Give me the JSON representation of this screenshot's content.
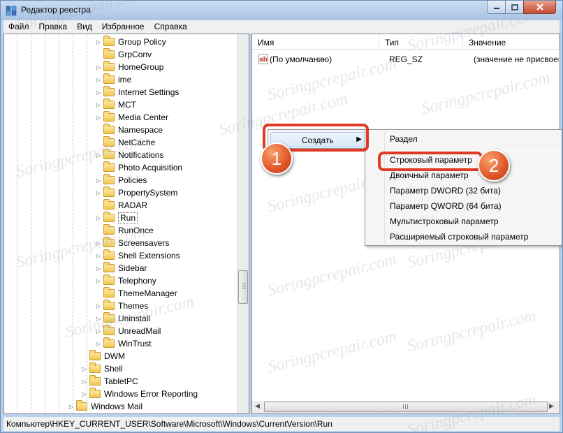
{
  "window": {
    "title": "Редактор реестра",
    "icons": {
      "app": "registry-editor-icon",
      "minimize": "minimize-icon",
      "maximize": "maximize-icon",
      "close": "close-icon"
    }
  },
  "menu": [
    "Файл",
    "Правка",
    "Вид",
    "Избранное",
    "Справка"
  ],
  "tree": {
    "items": [
      {
        "label": "Group Policy",
        "level": 2,
        "expandable": true
      },
      {
        "label": "GrpConv",
        "level": 2,
        "expandable": false
      },
      {
        "label": "HomeGroup",
        "level": 2,
        "expandable": true
      },
      {
        "label": "ime",
        "level": 2,
        "expandable": true
      },
      {
        "label": "Internet Settings",
        "level": 2,
        "expandable": true
      },
      {
        "label": "MCT",
        "level": 2,
        "expandable": true
      },
      {
        "label": "Media Center",
        "level": 2,
        "expandable": true
      },
      {
        "label": "Namespace",
        "level": 2,
        "expandable": false
      },
      {
        "label": "NetCache",
        "level": 2,
        "expandable": false
      },
      {
        "label": "Notifications",
        "level": 2,
        "expandable": true
      },
      {
        "label": "Photo Acquisition",
        "level": 2,
        "expandable": false
      },
      {
        "label": "Policies",
        "level": 2,
        "expandable": true
      },
      {
        "label": "PropertySystem",
        "level": 2,
        "expandable": true
      },
      {
        "label": "RADAR",
        "level": 2,
        "expandable": false
      },
      {
        "label": "Run",
        "level": 2,
        "expandable": true,
        "selected": true
      },
      {
        "label": "RunOnce",
        "level": 2,
        "expandable": false
      },
      {
        "label": "Screensavers",
        "level": 2,
        "expandable": true
      },
      {
        "label": "Shell Extensions",
        "level": 2,
        "expandable": true
      },
      {
        "label": "Sidebar",
        "level": 2,
        "expandable": true
      },
      {
        "label": "Telephony",
        "level": 2,
        "expandable": true
      },
      {
        "label": "ThemeManager",
        "level": 2,
        "expandable": false
      },
      {
        "label": "Themes",
        "level": 2,
        "expandable": true
      },
      {
        "label": "Uninstall",
        "level": 2,
        "expandable": true
      },
      {
        "label": "UnreadMail",
        "level": 2,
        "expandable": true
      },
      {
        "label": "WinTrust",
        "level": 2,
        "expandable": true
      },
      {
        "label": "DWM",
        "level": 1,
        "expandable": false
      },
      {
        "label": "Shell",
        "level": 1,
        "expandable": true
      },
      {
        "label": "TabletPC",
        "level": 1,
        "expandable": true
      },
      {
        "label": "Windows Error Reporting",
        "level": 1,
        "expandable": true
      },
      {
        "label": "Windows Mail",
        "level": 0,
        "expandable": true
      }
    ]
  },
  "list": {
    "columns": [
      "Имя",
      "Тип",
      "Значение"
    ],
    "rows": [
      {
        "name": "(По умолчанию)",
        "type": "REG_SZ",
        "value": "(значение не присвоено)",
        "icon": "string-value-icon",
        "icon_text": "ab"
      }
    ]
  },
  "context_menu": {
    "item": "Создать"
  },
  "submenu": {
    "items": [
      "Раздел",
      "Строковый параметр",
      "Двоичный параметр",
      "Параметр DWORD (32 бита)",
      "Параметр QWORD (64 бита)",
      "Мультистроковый параметр",
      "Расширяемый строковый параметр"
    ]
  },
  "callouts": [
    "1",
    "2"
  ],
  "statusbar": {
    "path": "Компьютер\\HKEY_CURRENT_USER\\Software\\Microsoft\\Windows\\CurrentVersion\\Run"
  },
  "watermark": "Soringpcrepair.com",
  "colors": {
    "highlight": "#e03a26",
    "badge": "#e0552a"
  }
}
